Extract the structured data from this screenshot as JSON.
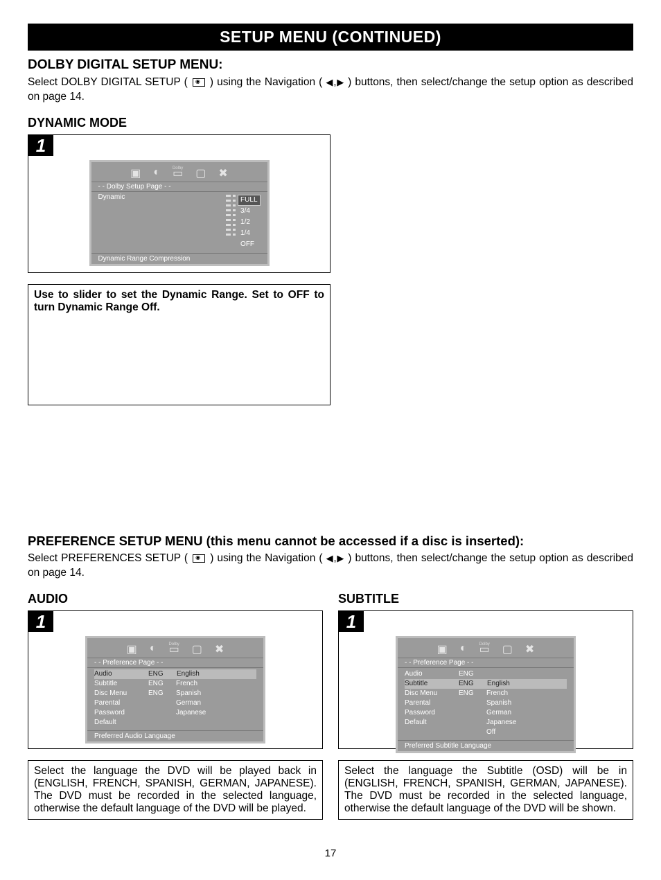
{
  "banner": "SETUP MENU (CONTINUED)",
  "dolby": {
    "heading": "DOLBY DIGITAL SETUP MENU:",
    "intro_pre": "Select DOLBY DIGITAL SETUP (",
    "intro_mid": ") using the Navigation (",
    "intro_post": ") buttons, then select/change the setup option as described on page 14."
  },
  "dynamic": {
    "heading": "DYNAMIC MODE",
    "step": "1",
    "screen_title": "- - Dolby Setup Page - -",
    "menu_item": "Dynamic",
    "ladder": [
      "FULL",
      "3/4",
      "1/2",
      "1/4",
      "OFF"
    ],
    "footer": "Dynamic Range Compression",
    "caption": "Use to slider to set the Dynamic Range. Set to OFF to turn Dynamic Range Off."
  },
  "pref": {
    "heading": "PREFERENCE SETUP MENU (this menu cannot be accessed if a disc is inserted):",
    "intro_pre": "Select PREFERENCES SETUP (",
    "intro_mid": ") using the Navigation (",
    "intro_post": ") buttons, then select/change the setup option as described on page 14."
  },
  "audio": {
    "heading": "AUDIO",
    "step": "1",
    "screen_title": "- - Preference Page - -",
    "rows": [
      {
        "label": "Audio",
        "val": "ENG",
        "opt": "English",
        "hl_label": true,
        "hl_opt": true
      },
      {
        "label": "Subtitle",
        "val": "ENG",
        "opt": "French"
      },
      {
        "label": "Disc Menu",
        "val": "ENG",
        "opt": "Spanish"
      },
      {
        "label": "Parental",
        "val": "",
        "opt": "German"
      },
      {
        "label": "Password",
        "val": "",
        "opt": "Japanese"
      },
      {
        "label": "Default",
        "val": "",
        "opt": ""
      }
    ],
    "footer": "Preferred Audio Language",
    "caption": "Select the language the DVD will be played back in (ENGLISH, FRENCH, SPANISH, GERMAN, JAPANESE). The DVD must be recorded in the selected language, otherwise the default language of the DVD will be played."
  },
  "subtitle": {
    "heading": "SUBTITLE",
    "step": "1",
    "screen_title": "- - Preference Page - -",
    "rows": [
      {
        "label": "Audio",
        "val": "ENG",
        "opt": ""
      },
      {
        "label": "Subtitle",
        "val": "ENG",
        "opt": "English",
        "hl_label": true,
        "hl_opt": true
      },
      {
        "label": "Disc Menu",
        "val": "ENG",
        "opt": "French"
      },
      {
        "label": "Parental",
        "val": "",
        "opt": "Spanish"
      },
      {
        "label": "Password",
        "val": "",
        "opt": "German"
      },
      {
        "label": "Default",
        "val": "",
        "opt": "Japanese"
      },
      {
        "label": "",
        "val": "",
        "opt": "Off"
      }
    ],
    "footer": "Preferred Subtitle Language",
    "caption": "Select the language the Subtitle (OSD) will be in (ENGLISH, FRENCH, SPANISH, GERMAN, JAPANESE). The DVD must be recorded in the selected language, otherwise the default language of the DVD will be shown."
  },
  "page_number": "17",
  "icons": {
    "dolby_label": "Dolby"
  }
}
